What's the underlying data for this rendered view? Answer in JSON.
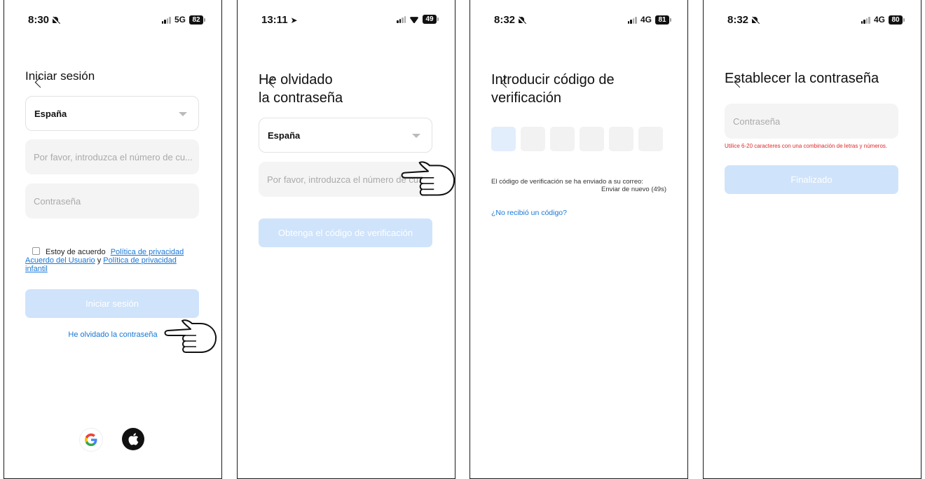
{
  "screens": [
    {
      "time": "8:30",
      "network": "5G",
      "battery": "82",
      "title": "Iniciar sesión",
      "country": "España",
      "phone_placeholder": "Por favor, introduzca el número de cu...",
      "password_placeholder": "Contraseña",
      "agree_text": "Estoy de acuerdo",
      "privacy_link": "Política de privacidad",
      "user_agreement_link": "Acuerdo del Usuario",
      "and_text": "y",
      "child_privacy_link": "Política de privacidad infantil",
      "login_button": "Iniciar sesión",
      "forgot_link": "He olvidado la contraseña"
    },
    {
      "time": "13:11",
      "battery": "49",
      "title_line1": "He olvidado",
      "title_line2": "la contraseña",
      "country": "España",
      "phone_placeholder": "Por favor, introduzca el número de cu...",
      "code_button": "Obtenga el código de verificación"
    },
    {
      "time": "8:32",
      "network": "4G",
      "battery": "81",
      "title_line1": "Introducir código de",
      "title_line2": "verificación",
      "sent_text": "El código de verificación se ha enviado a su correo:",
      "resend_text": "Enviar de nuevo (49s)",
      "no_code_link": "¿No recibió un código?"
    },
    {
      "time": "8:32",
      "network": "4G",
      "battery": "80",
      "title": "Establecer la contraseña",
      "password_placeholder": "Contraseña",
      "hint": "Utilice 6-20 caracteres con una combinación de letras y números.",
      "finish_button": "Finalizado"
    }
  ]
}
